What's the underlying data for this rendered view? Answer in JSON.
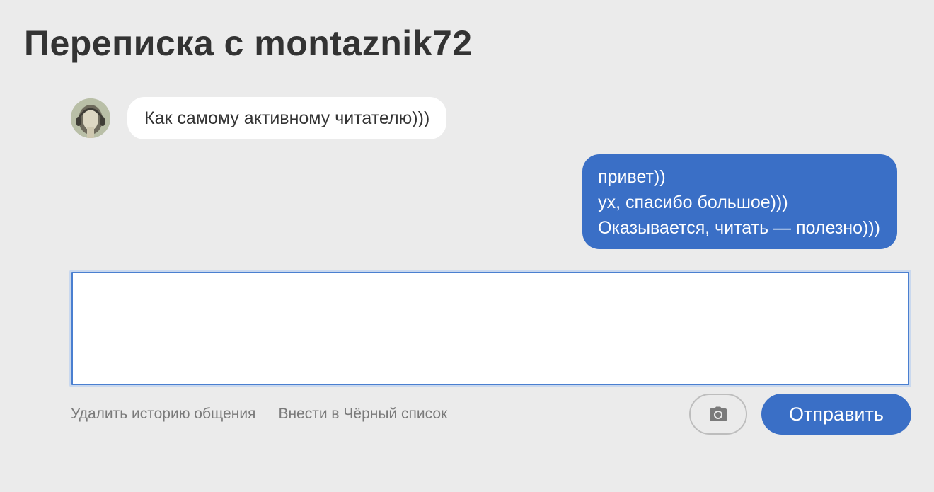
{
  "page": {
    "title": "Переписка с montaznik72"
  },
  "messages": {
    "incoming": {
      "text": "Как самому активному читателю)))"
    },
    "outgoing": {
      "lines": [
        "привет))",
        "ух, спасибо большое)))",
        "Оказывается, читать — полезно)))"
      ]
    }
  },
  "composer": {
    "value": "",
    "placeholder": ""
  },
  "actions": {
    "delete_history_label": "Удалить историю общения",
    "blacklist_label": "Внести в Чёрный список",
    "photo_icon": "camera-icon",
    "send_label": "Отправить"
  },
  "colors": {
    "background": "#ebebeb",
    "accent": "#3a6fc6",
    "incoming_bubble": "#ffffff",
    "link": "#7a7a7a",
    "title": "#333333"
  }
}
